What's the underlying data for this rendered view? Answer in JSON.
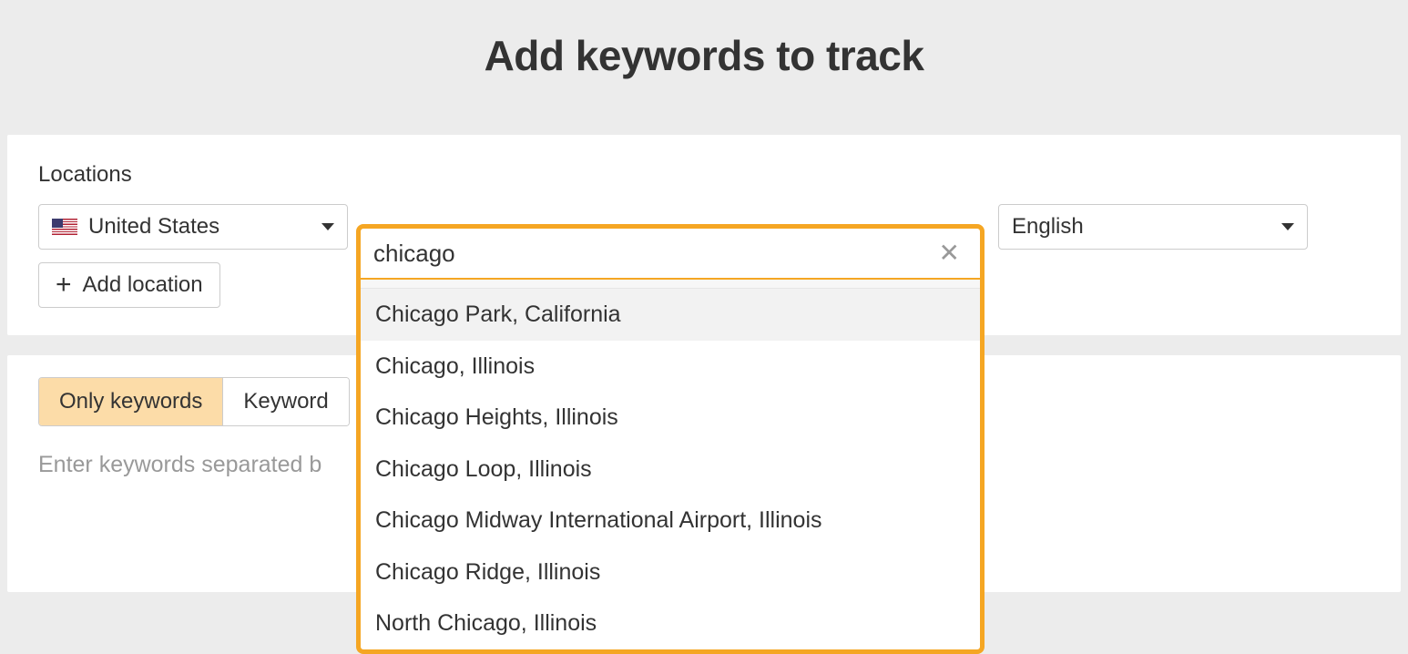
{
  "title": "Add keywords to track",
  "locations_label": "Locations",
  "country_select": {
    "value": "United States"
  },
  "location_search": {
    "value": "chicago",
    "suggestions": [
      "Chicago Park, California",
      "Chicago, Illinois",
      "Chicago Heights, Illinois",
      "Chicago Loop, Illinois",
      "Chicago Midway International Airport, Illinois",
      "Chicago Ridge, Illinois",
      "North Chicago, Illinois"
    ]
  },
  "language_select": {
    "value": "English"
  },
  "add_location_label": "Add location",
  "tabs": {
    "only_keywords": "Only keywords",
    "keywords_partial": "Keyword"
  },
  "keywords_placeholder": "Enter keywords separated b"
}
